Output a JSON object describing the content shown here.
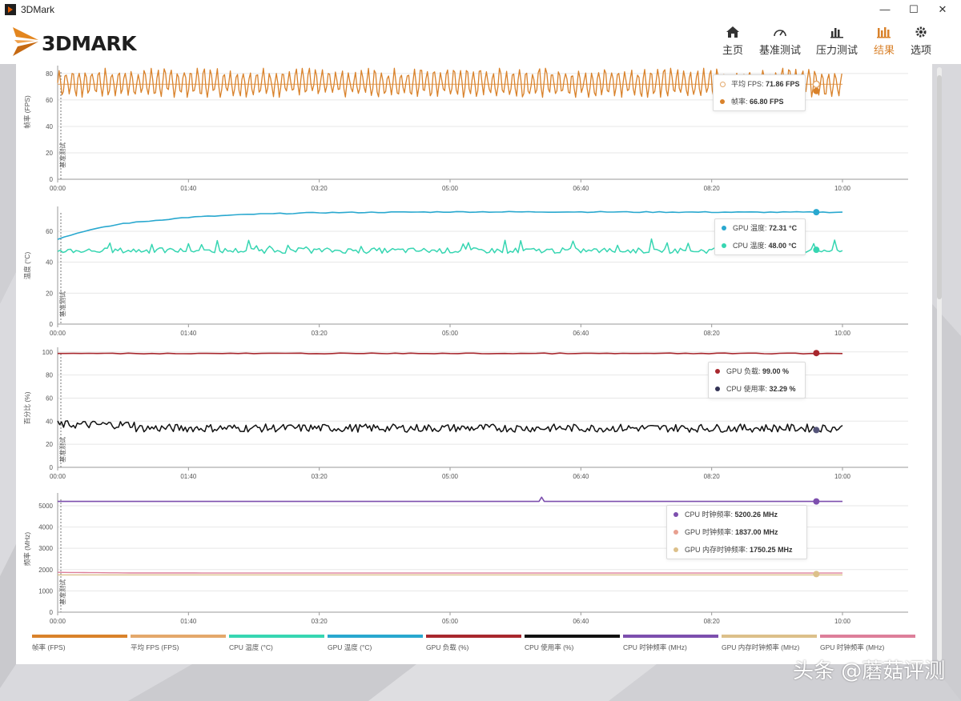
{
  "window": {
    "title": "3DMark"
  },
  "brand": {
    "logo_text": "3DMARK"
  },
  "nav": [
    {
      "label": "主页",
      "icon": "home-icon",
      "active": false
    },
    {
      "label": "基准测试",
      "icon": "gauge-icon",
      "active": false
    },
    {
      "label": "压力测试",
      "icon": "stress-bars-icon",
      "active": false
    },
    {
      "label": "结果",
      "icon": "results-bars-icon",
      "active": true
    },
    {
      "label": "选项",
      "icon": "gear-icon",
      "active": false
    }
  ],
  "colors": {
    "accent": "#d9822b",
    "fps": "#d9822b",
    "avg_fps": "#e4a86b",
    "cpu_temp": "#37d6b2",
    "gpu_temp": "#29a8cf",
    "gpu_load": "#a8282e",
    "cpu_usage": "#111111",
    "cpu_clock": "#7d4fae",
    "gpu_mem_clock": "#dcc08a",
    "gpu_clock": "#dd7f9a"
  },
  "time_axis": [
    "00:00",
    "01:40",
    "03:20",
    "05:00",
    "06:40",
    "08:20",
    "10:00"
  ],
  "event_marker_label": "基准测试",
  "chart_data": [
    {
      "type": "line",
      "ylabel": "帧率 (FPS)",
      "y_ticks": [
        "0",
        "20",
        "40",
        "60",
        "80"
      ],
      "ylim": [
        0,
        86
      ],
      "xlim_seconds": [
        0,
        600
      ],
      "series": [
        {
          "name": "帧率 (FPS)",
          "pattern": "oscillating",
          "approx_min": 62,
          "approx_max": 84,
          "end_value": 66.8
        },
        {
          "name": "平均 FPS",
          "values": [
            71.86,
            71.86
          ]
        }
      ],
      "tooltip": [
        {
          "label": "平均 FPS",
          "value": "71.86 FPS"
        },
        {
          "label": "帧率",
          "value": "66.80 FPS"
        }
      ]
    },
    {
      "type": "line",
      "ylabel": "温度 (°C)",
      "y_ticks": [
        "0",
        "20",
        "40",
        "60"
      ],
      "ylim": [
        0,
        76
      ],
      "xlim_seconds": [
        0,
        600
      ],
      "series": [
        {
          "name": "GPU 温度",
          "x": [
            0,
            20,
            50,
            100,
            150,
            200,
            300,
            400,
            500,
            600
          ],
          "values": [
            55,
            60,
            65,
            69,
            71,
            72,
            72.5,
            72.5,
            72.3,
            72.3
          ]
        },
        {
          "name": "CPU 温度",
          "pattern": "noisy",
          "approx_min": 44,
          "approx_max": 55,
          "end_value": 48.0
        }
      ],
      "tooltip": [
        {
          "label": "GPU 温度",
          "value": "72.31 °C"
        },
        {
          "label": "CPU 温度",
          "value": "48.00 °C"
        }
      ]
    },
    {
      "type": "line",
      "ylabel": "百分比 (%)",
      "y_ticks": [
        "0",
        "20",
        "40",
        "60",
        "80",
        "100"
      ],
      "ylim": [
        0,
        104
      ],
      "xlim_seconds": [
        0,
        600
      ],
      "series": [
        {
          "name": "GPU 负载",
          "values": [
            99,
            99
          ],
          "end_value": 99.0
        },
        {
          "name": "CPU 使用率",
          "pattern": "noisy",
          "approx_min": 26,
          "approx_max": 42,
          "end_value": 32.29
        }
      ],
      "tooltip": [
        {
          "label": "GPU 负载",
          "value": "99.00 %"
        },
        {
          "label": "CPU 使用率",
          "value": "32.29 %"
        }
      ]
    },
    {
      "type": "line",
      "ylabel": "频率 (MHz)",
      "y_ticks": [
        "0",
        "1000",
        "2000",
        "3000",
        "4000",
        "5000"
      ],
      "ylim": [
        0,
        5600
      ],
      "xlim_seconds": [
        0,
        600
      ],
      "series": [
        {
          "name": "CPU 时钟频率",
          "values": [
            5200.26,
            5200.26
          ],
          "spike": {
            "x": 370,
            "value": 5400
          }
        },
        {
          "name": "GPU 时钟频率",
          "x": [
            0,
            60,
            600
          ],
          "values": [
            1870,
            1840,
            1837
          ]
        },
        {
          "name": "GPU 内存时钟频率",
          "values": [
            1750.25,
            1750.25
          ]
        }
      ],
      "tooltip": [
        {
          "label": "CPU 时钟频率",
          "value": "5200.26 MHz"
        },
        {
          "label": "GPU 时钟频率",
          "value": "1837.00 MHz"
        },
        {
          "label": "GPU 内存时钟频率",
          "value": "1750.25 MHz"
        }
      ]
    }
  ],
  "legend": [
    {
      "label": "帧率 (FPS)",
      "color": "#d9822b"
    },
    {
      "label": "平均 FPS (FPS)",
      "color": "#e4a86b"
    },
    {
      "label": "CPU 温度 (°C)",
      "color": "#37d6b2"
    },
    {
      "label": "GPU 温度 (°C)",
      "color": "#29a8cf"
    },
    {
      "label": "GPU 负载 (%)",
      "color": "#a8282e"
    },
    {
      "label": "CPU 使用率 (%)",
      "color": "#111111"
    },
    {
      "label": "CPU 时钟频率 (MHz)",
      "color": "#7d4fae"
    },
    {
      "label": "GPU 内存时钟频率 (MHz)",
      "color": "#dcc08a"
    },
    {
      "label": "GPU 时钟频率 (MHz)",
      "color": "#dd7f9a"
    }
  ],
  "watermark": "头条 @蘑菇评测"
}
